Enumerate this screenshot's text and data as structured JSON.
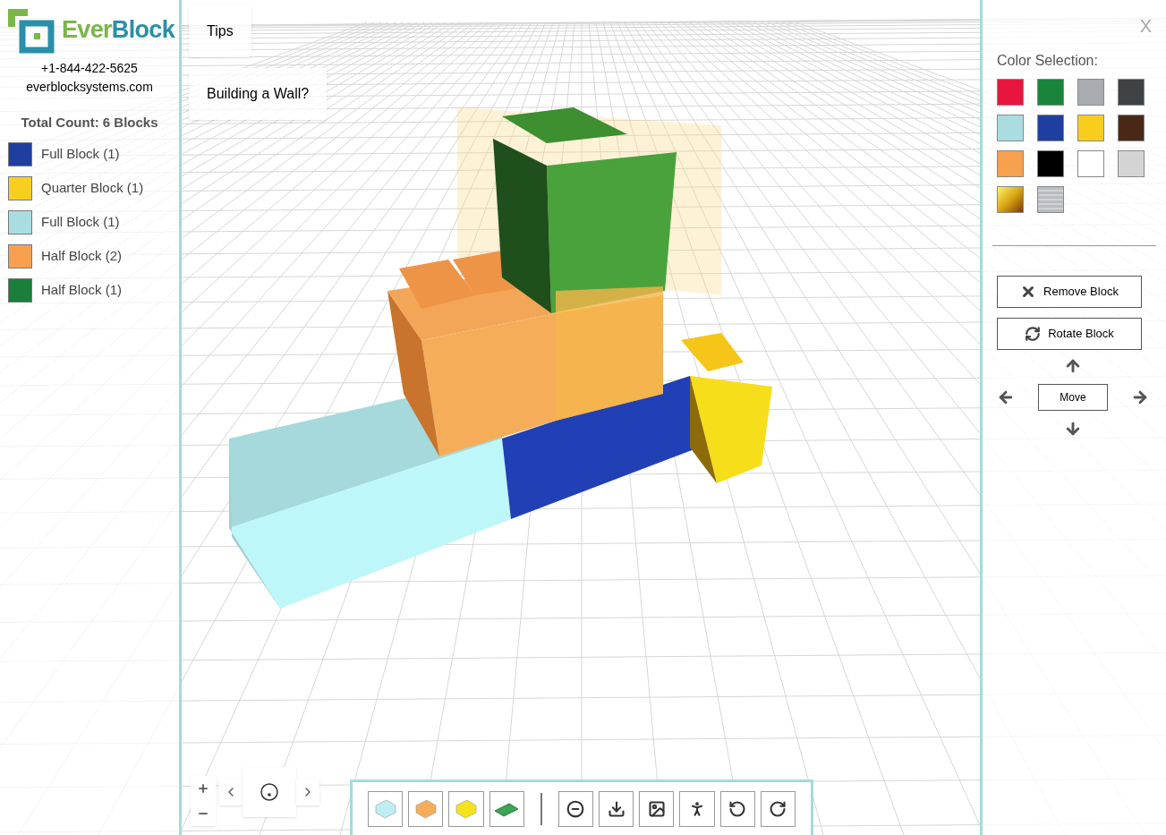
{
  "brand": {
    "logo_text": "EverBlock",
    "phone": "+1-844-422-5625",
    "website": "everblocksystems.com"
  },
  "total_count": "Total Count: 6 Blocks",
  "legend": [
    {
      "label": "Full Block (1)",
      "color": "#1f3fa0"
    },
    {
      "label": "Quarter Block (1)",
      "color": "#f9cf1f"
    },
    {
      "label": "Full Block (1)",
      "color": "#a8dee2"
    },
    {
      "label": "Half Block (2)",
      "color": "#f7a04f"
    },
    {
      "label": "Half Block (1)",
      "color": "#1a7f3b"
    }
  ],
  "tips": [
    {
      "label": "Tips"
    },
    {
      "label": "Building a Wall?"
    }
  ],
  "close": "X",
  "color_selection": {
    "title": "Color Selection:",
    "swatches": [
      {
        "kind": "solid",
        "color": "#e8163f"
      },
      {
        "kind": "solid",
        "color": "#1a843c"
      },
      {
        "kind": "solid",
        "color": "#a9adb0"
      },
      {
        "kind": "solid",
        "color": "#3f4245"
      },
      {
        "kind": "solid",
        "color": "#a9dde0"
      },
      {
        "kind": "solid",
        "color": "#1e3ea0"
      },
      {
        "kind": "solid",
        "color": "#f9cd1e"
      },
      {
        "kind": "solid",
        "color": "#4a2818"
      },
      {
        "kind": "solid",
        "color": "#f7a04d"
      },
      {
        "kind": "solid",
        "color": "#000000"
      },
      {
        "kind": "solid",
        "color": "#ffffff"
      },
      {
        "kind": "solid",
        "color": "#d4d4d4"
      },
      {
        "kind": "gold",
        "color": "#d9a514"
      },
      {
        "kind": "metallic",
        "color": "#b8bcc0"
      }
    ]
  },
  "actions": [
    "Remove Block",
    "Rotate Block"
  ],
  "move": "Move"
}
